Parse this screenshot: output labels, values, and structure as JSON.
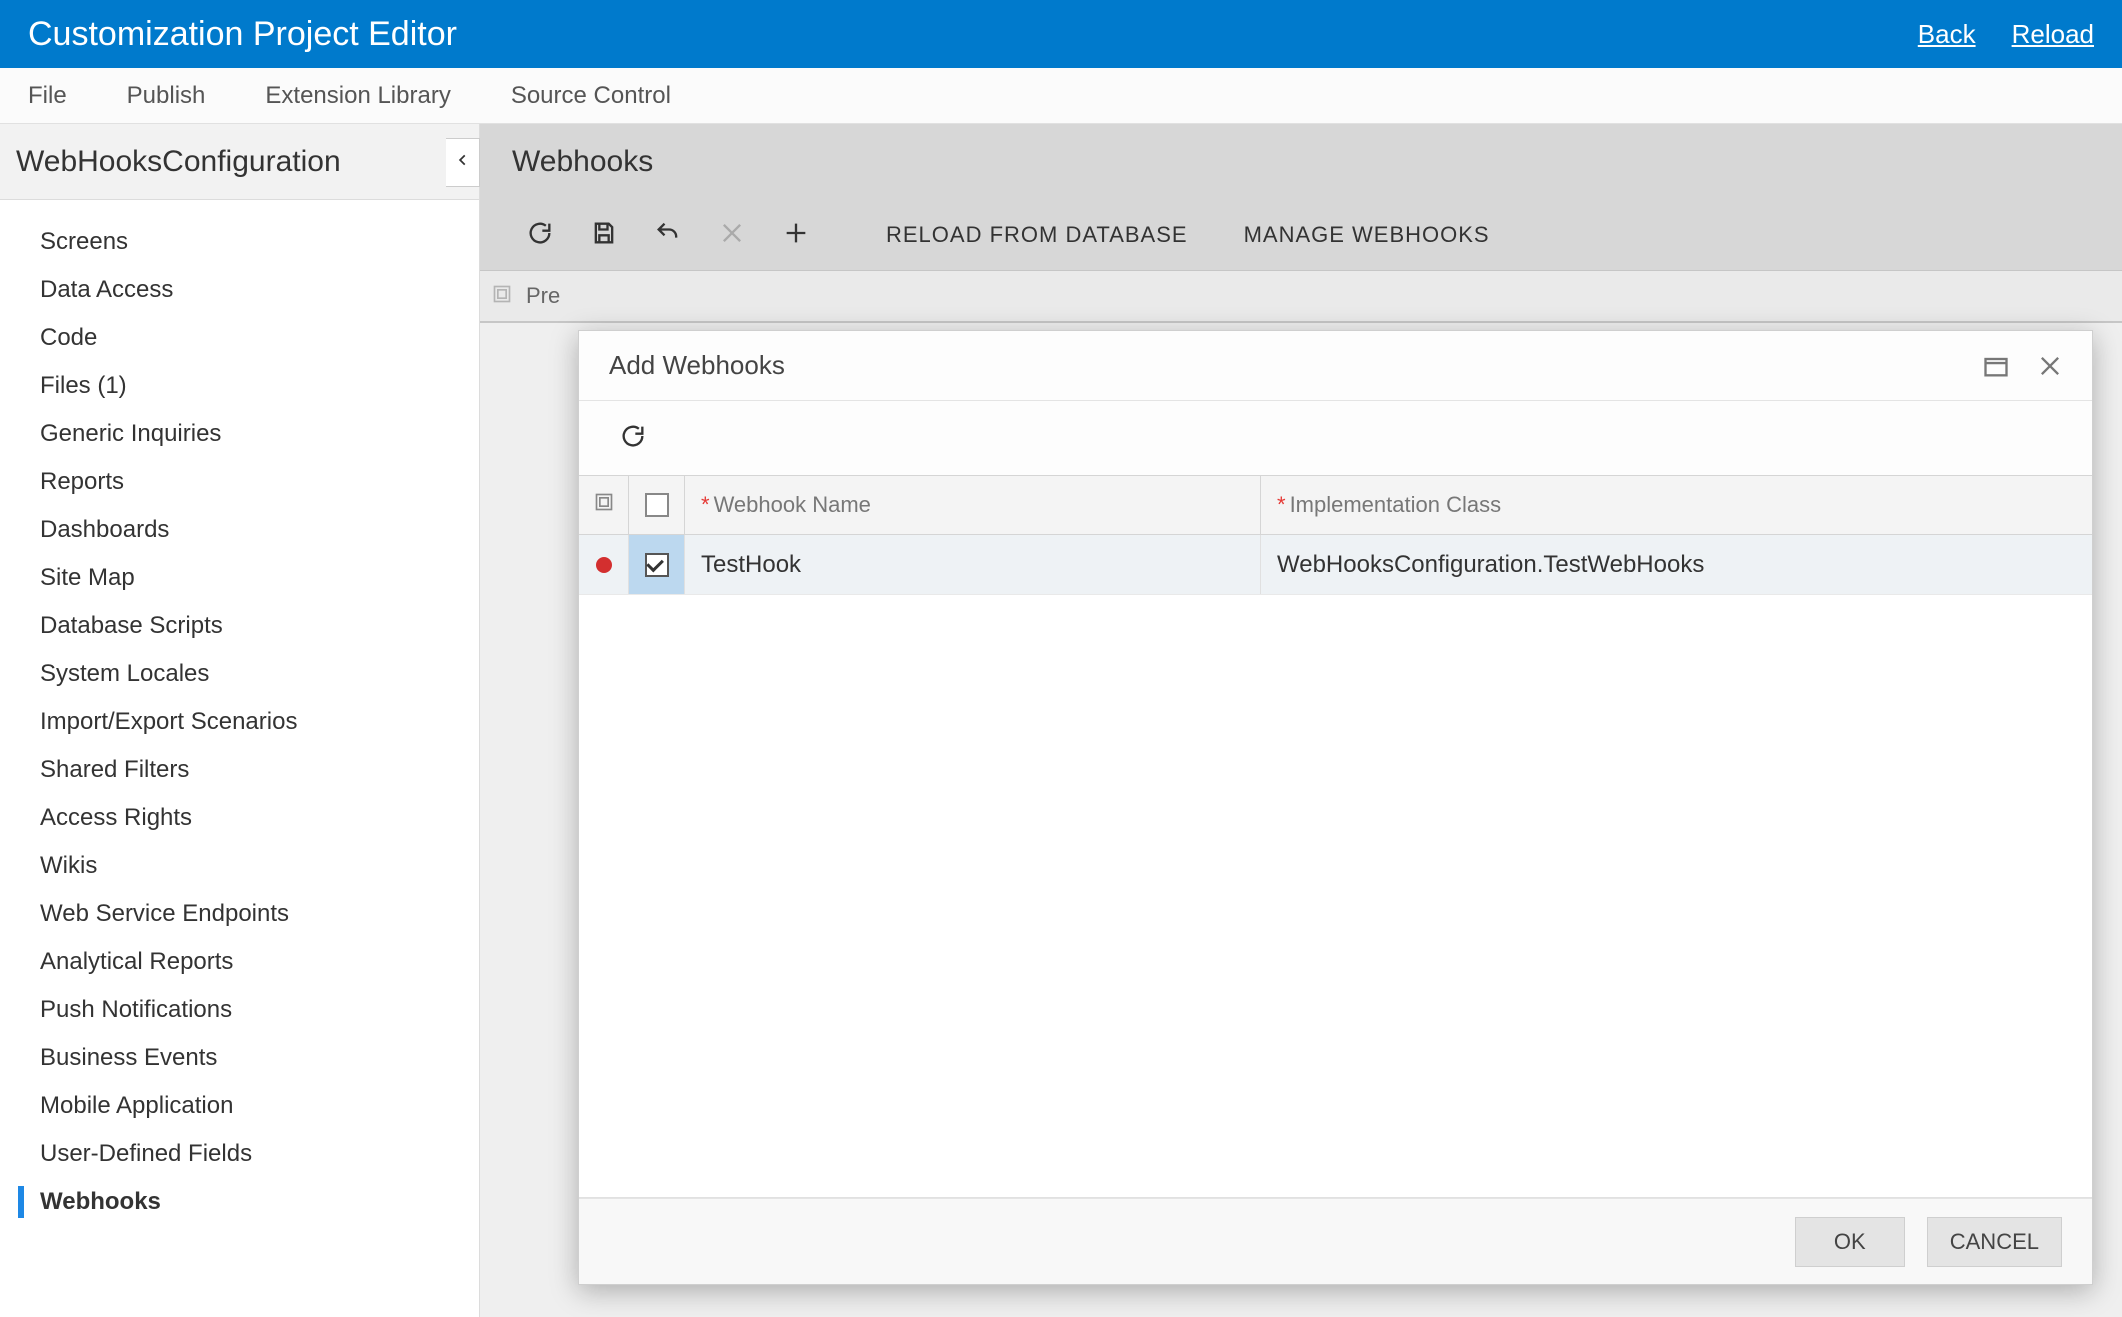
{
  "header": {
    "title": "Customization Project Editor",
    "back": "Back",
    "reload": "Reload"
  },
  "menu": {
    "file": "File",
    "publish": "Publish",
    "extension_library": "Extension Library",
    "source_control": "Source Control"
  },
  "sidebar": {
    "title": "WebHooksConfiguration",
    "items": [
      "Screens",
      "Data Access",
      "Code",
      "Files (1)",
      "Generic Inquiries",
      "Reports",
      "Dashboards",
      "Site Map",
      "Database Scripts",
      "System Locales",
      "Import/Export Scenarios",
      "Shared Filters",
      "Access Rights",
      "Wikis",
      "Web Service Endpoints",
      "Analytical Reports",
      "Push Notifications",
      "Business Events",
      "Mobile Application",
      "User-Defined Fields",
      "Webhooks"
    ],
    "active_index": 20
  },
  "main": {
    "title": "Webhooks",
    "toolbar": {
      "reload_db": "RELOAD FROM DATABASE",
      "manage": "MANAGE WEBHOOKS"
    },
    "bg_strip_text": "Pre"
  },
  "modal": {
    "title": "Add Webhooks",
    "columns": {
      "name": "Webhook Name",
      "impl": "Implementation Class"
    },
    "rows": [
      {
        "checked": true,
        "dirty": true,
        "name": "TestHook",
        "impl": "WebHooksConfiguration.TestWebHooks"
      }
    ],
    "buttons": {
      "ok": "OK",
      "cancel": "CANCEL"
    }
  }
}
